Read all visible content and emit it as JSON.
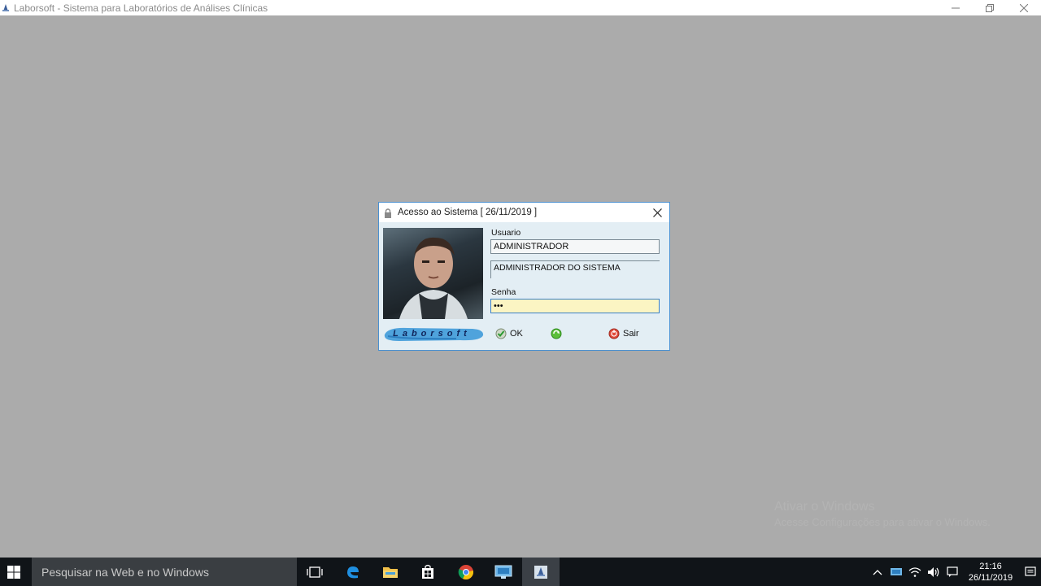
{
  "window": {
    "title": "Laborsoft - Sistema para Laboratórios de Análises Clínicas"
  },
  "dialog": {
    "title": "Acesso ao Sistema [ 26/11/2019 ]",
    "usuario_label": "Usuario",
    "usuario_value": "ADMINISTRADOR",
    "usuario_name": "ADMINISTRADOR DO SISTEMA",
    "senha_label": "Senha",
    "senha_value": "•••",
    "logo_text": "Laborsoft",
    "ok_label": "OK",
    "sair_label": "Sair"
  },
  "watermark": {
    "line1": "Ativar o Windows",
    "line2": "Acesse Configurações para ativar o Windows."
  },
  "taskbar": {
    "search_placeholder": "Pesquisar na Web e no Windows",
    "time": "21:16",
    "date": "26/11/2019"
  },
  "colors": {
    "desktop_bg": "#ababab",
    "dialog_border": "#4a90d0",
    "password_bg": "#fbf5c3",
    "taskbar_bg": "#101418"
  }
}
